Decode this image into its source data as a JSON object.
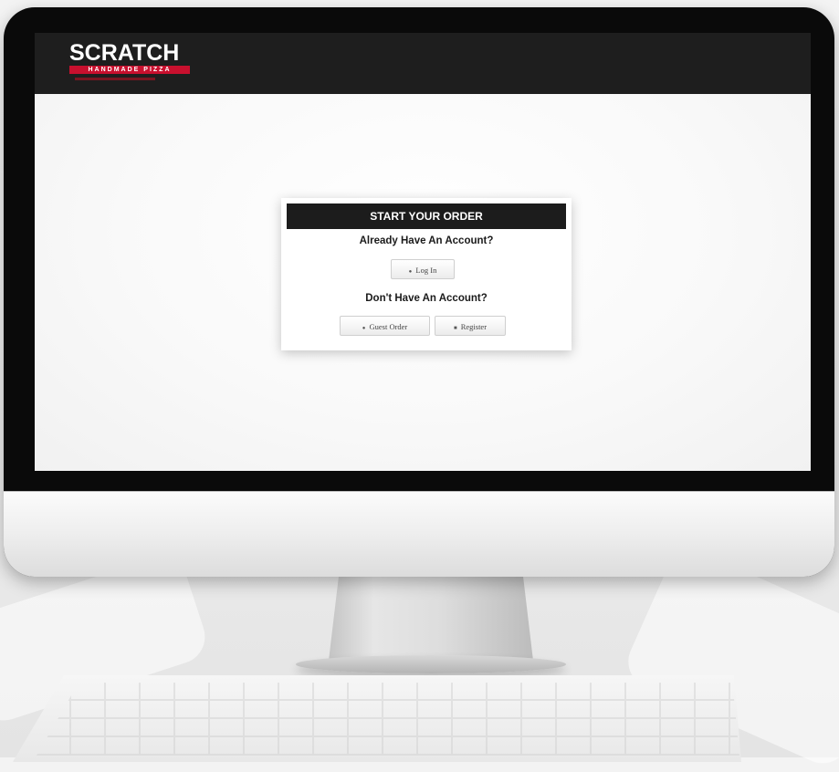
{
  "site": {
    "logo_word": "SCRATCH",
    "logo_tagline": "HANDMADE PIZZA",
    "brand_red": "#c8102e",
    "header_color": "#1e1e1e"
  },
  "order_panel": {
    "title": "START YOUR ORDER",
    "existing_heading": "Already Have An Account?",
    "login_label": "Log In",
    "new_heading": "Don't Have An Account?",
    "guest_label": "Guest Order",
    "register_label": "Register"
  },
  "icons": {
    "login": "user-icon",
    "guest": "user-icon",
    "register": "register-icon"
  }
}
